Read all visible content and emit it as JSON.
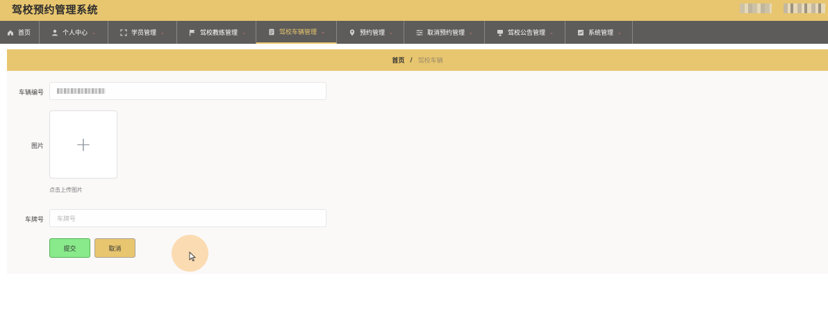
{
  "app": {
    "title": "驾校预约管理系统"
  },
  "nav": {
    "items": [
      {
        "label": "首页",
        "icon": "home-icon"
      },
      {
        "label": "个人中心",
        "icon": "user-icon",
        "has_caret": true
      },
      {
        "label": "学员管理",
        "icon": "expand-icon",
        "has_caret": true
      },
      {
        "label": "驾校教练管理",
        "icon": "flag-icon",
        "has_caret": true
      },
      {
        "label": "驾校车辆管理",
        "icon": "document-icon",
        "has_caret": true,
        "active": true
      },
      {
        "label": "预约管理",
        "icon": "location-icon",
        "has_caret": true
      },
      {
        "label": "取消预约管理",
        "icon": "sliders-icon",
        "has_caret": true
      },
      {
        "label": "驾校公告管理",
        "icon": "monitor-icon",
        "has_caret": true
      },
      {
        "label": "系统管理",
        "icon": "chart-icon",
        "has_caret": true
      }
    ],
    "caret": "⌄"
  },
  "breadcrumb": {
    "home": "首页",
    "separator": "/",
    "current": "驾校车辆"
  },
  "form": {
    "vehicle_no": {
      "label": "车辆编号"
    },
    "image": {
      "label": "图片",
      "upload_tip": "点击上传图片",
      "plus": "+"
    },
    "plate": {
      "label": "车牌号",
      "placeholder": "车牌号"
    }
  },
  "actions": {
    "submit": "提交",
    "cancel": "取消"
  },
  "colors": {
    "header_bg": "#e8c66f",
    "nav_bg": "#5e5c5a",
    "active_accent": "#e8c66f",
    "submit_bg": "#88ea8a",
    "cancel_bg": "#e8c66f"
  }
}
